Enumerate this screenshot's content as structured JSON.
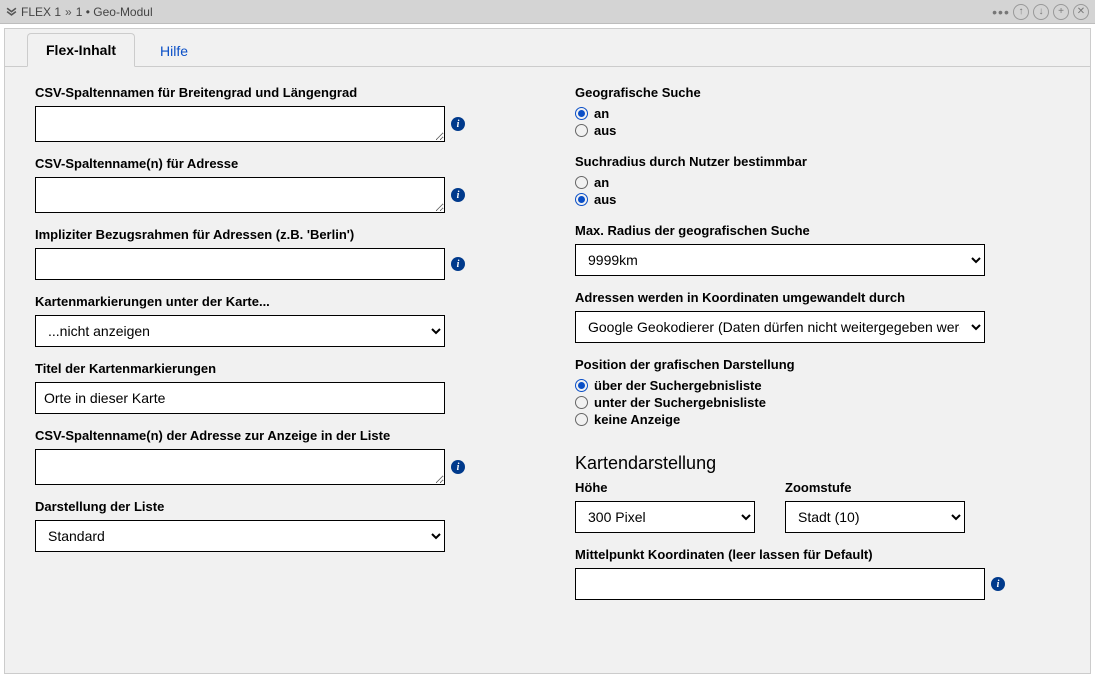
{
  "titlebar": {
    "crumb1": "FLEX 1",
    "crumb2": "1 • Geo-Modul"
  },
  "tabs": {
    "t1": "Flex-Inhalt",
    "t2": "Hilfe"
  },
  "left": {
    "csv_latlon_label": "CSV-Spaltennamen für Breitengrad und Längengrad",
    "csv_latlon_value": "",
    "csv_addr_label": "CSV-Spaltenname(n) für Adresse",
    "csv_addr_value": "",
    "imp_ref_label": "Impliziter Bezugsrahmen für Adressen (z.B. 'Berlin')",
    "imp_ref_value": "",
    "markers_select_label": "Kartenmarkierungen unter der Karte...",
    "markers_select_value": "...nicht anzeigen",
    "marker_title_label": "Titel der Kartenmarkierungen",
    "marker_title_value": "Orte in dieser Karte",
    "addr_list_col_label": "CSV-Spaltenname(n) der Adresse zur Anzeige in der Liste",
    "addr_list_col_value": "",
    "list_view_label": "Darstellung der Liste",
    "list_view_value": "Standard"
  },
  "right": {
    "geo_search_label": "Geografische Suche",
    "on": "an",
    "off": "aus",
    "user_radius_label": "Suchradius durch Nutzer bestimmbar",
    "max_radius_label": "Max. Radius der geografischen Suche",
    "max_radius_value": "9999km",
    "geocoder_label": "Adressen werden in Koordinaten umgewandelt durch",
    "geocoder_value": "Google Geokodierer (Daten dürfen nicht weitergegeben werden)",
    "pos_label": "Position der grafischen Darstellung",
    "pos_opt1": "über der Suchergebnisliste",
    "pos_opt2": "unter der Suchergebnisliste",
    "pos_opt3": "keine Anzeige",
    "map_section": "Kartendarstellung",
    "height_label": "Höhe",
    "height_value": "300 Pixel",
    "zoom_label": "Zoomstufe",
    "zoom_value": "Stadt (10)",
    "center_label": "Mittelpunkt Koordinaten (leer lassen für Default)",
    "center_value": ""
  }
}
